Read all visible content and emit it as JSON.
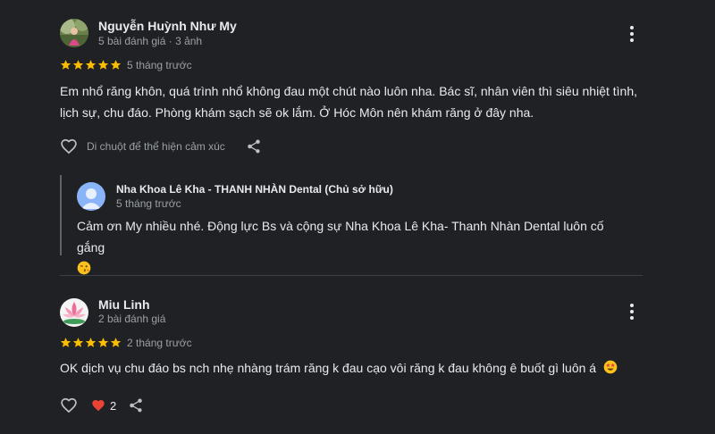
{
  "reviews": [
    {
      "author": "Nguyễn Huỳnh Như My",
      "author_meta": "5 bài đánh giá · 3 ảnh",
      "rating": 5,
      "time": "5 tháng trước",
      "text_line1": "Em nhổ răng khôn, quá trình nhổ không đau một chút nào luôn nha. Bác sĩ, nhân viên thì siêu nhiệt tình,",
      "text_line2": "lịch sự, chu đáo. Phòng khám sạch sẽ ok lắm. Ở Hóc Môn nên khám răng ở đây nha.",
      "hover_hint": "Di chuột để thể hiện cảm xúc",
      "reply": {
        "owner": "Nha Khoa Lê Kha - THANH NHÀN Dental (Chủ sở hữu)",
        "time": "5 tháng trước",
        "text": "Cảm ơn My nhiều nhé. Động lực Bs và cộng sự Nha Khoa Lê Kha- Thanh Nhàn Dental luôn cố gắng"
      }
    },
    {
      "author": "Miu Linh",
      "author_meta": "2 bài đánh giá",
      "rating": 5,
      "time": "2 tháng trước",
      "text_line1": "OK dịch vụ chu đáo bs nch nhẹ nhàng trám răng k đau cạo vôi răng k đau không ê buốt gì luôn á",
      "reaction_count": "2"
    }
  ],
  "colors": {
    "background": "#202124",
    "star": "#fbbc04",
    "heart": "#ea4335",
    "owner_avatar": "#8ab4f8"
  },
  "icons": [
    "avatar-photo",
    "lotus-avatar",
    "star-icon",
    "more-vert-icon",
    "heart-outline-icon",
    "heart-filled-icon",
    "share-icon",
    "owner-avatar-icon",
    "wink-kiss-emoji",
    "star-struck-emoji"
  ]
}
